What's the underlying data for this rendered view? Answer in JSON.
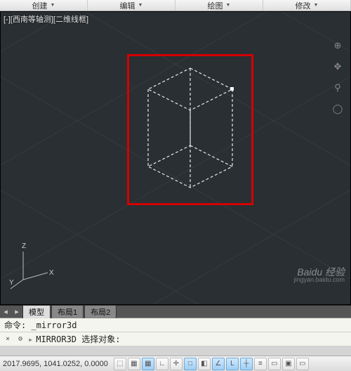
{
  "ribbon": {
    "panels": [
      "创建",
      "编辑",
      "绘图",
      "修改"
    ]
  },
  "viewport": {
    "label": "[-][西南等轴测][二维线框]",
    "ucs": {
      "x": "X",
      "y": "Y",
      "z": "Z"
    }
  },
  "tabs": {
    "items": [
      "模型",
      "布局1",
      "布局2"
    ],
    "active": 0
  },
  "command": {
    "history": "命令:  _mirror3d",
    "prompt_icon": "⨯",
    "prompt": "MIRROR3D 选择对象:"
  },
  "status": {
    "coords": "2017.9695, 1041.0252, 0.0000",
    "buttons": [
      {
        "name": "infer",
        "glyph": "⬚",
        "on": false
      },
      {
        "name": "snap",
        "glyph": "▦",
        "on": false
      },
      {
        "name": "grid",
        "glyph": "▦",
        "on": true
      },
      {
        "name": "ortho",
        "glyph": "∟",
        "on": false
      },
      {
        "name": "polar",
        "glyph": "✛",
        "on": false
      },
      {
        "name": "osnap",
        "glyph": "□",
        "on": true
      },
      {
        "name": "3dosnap",
        "glyph": "◧",
        "on": false
      },
      {
        "name": "otrack",
        "glyph": "∠",
        "on": true
      },
      {
        "name": "ducs",
        "glyph": "L",
        "on": true
      },
      {
        "name": "dyn",
        "glyph": "┼",
        "on": true
      },
      {
        "name": "lwt",
        "glyph": "≡",
        "on": false
      },
      {
        "name": "tpy",
        "glyph": "▭",
        "on": false
      },
      {
        "name": "qp",
        "glyph": "▣",
        "on": false
      },
      {
        "name": "sc",
        "glyph": "▭",
        "on": false
      }
    ]
  },
  "watermark": {
    "brand": "Baidu 经验",
    "url": "jingyan.baidu.com"
  }
}
